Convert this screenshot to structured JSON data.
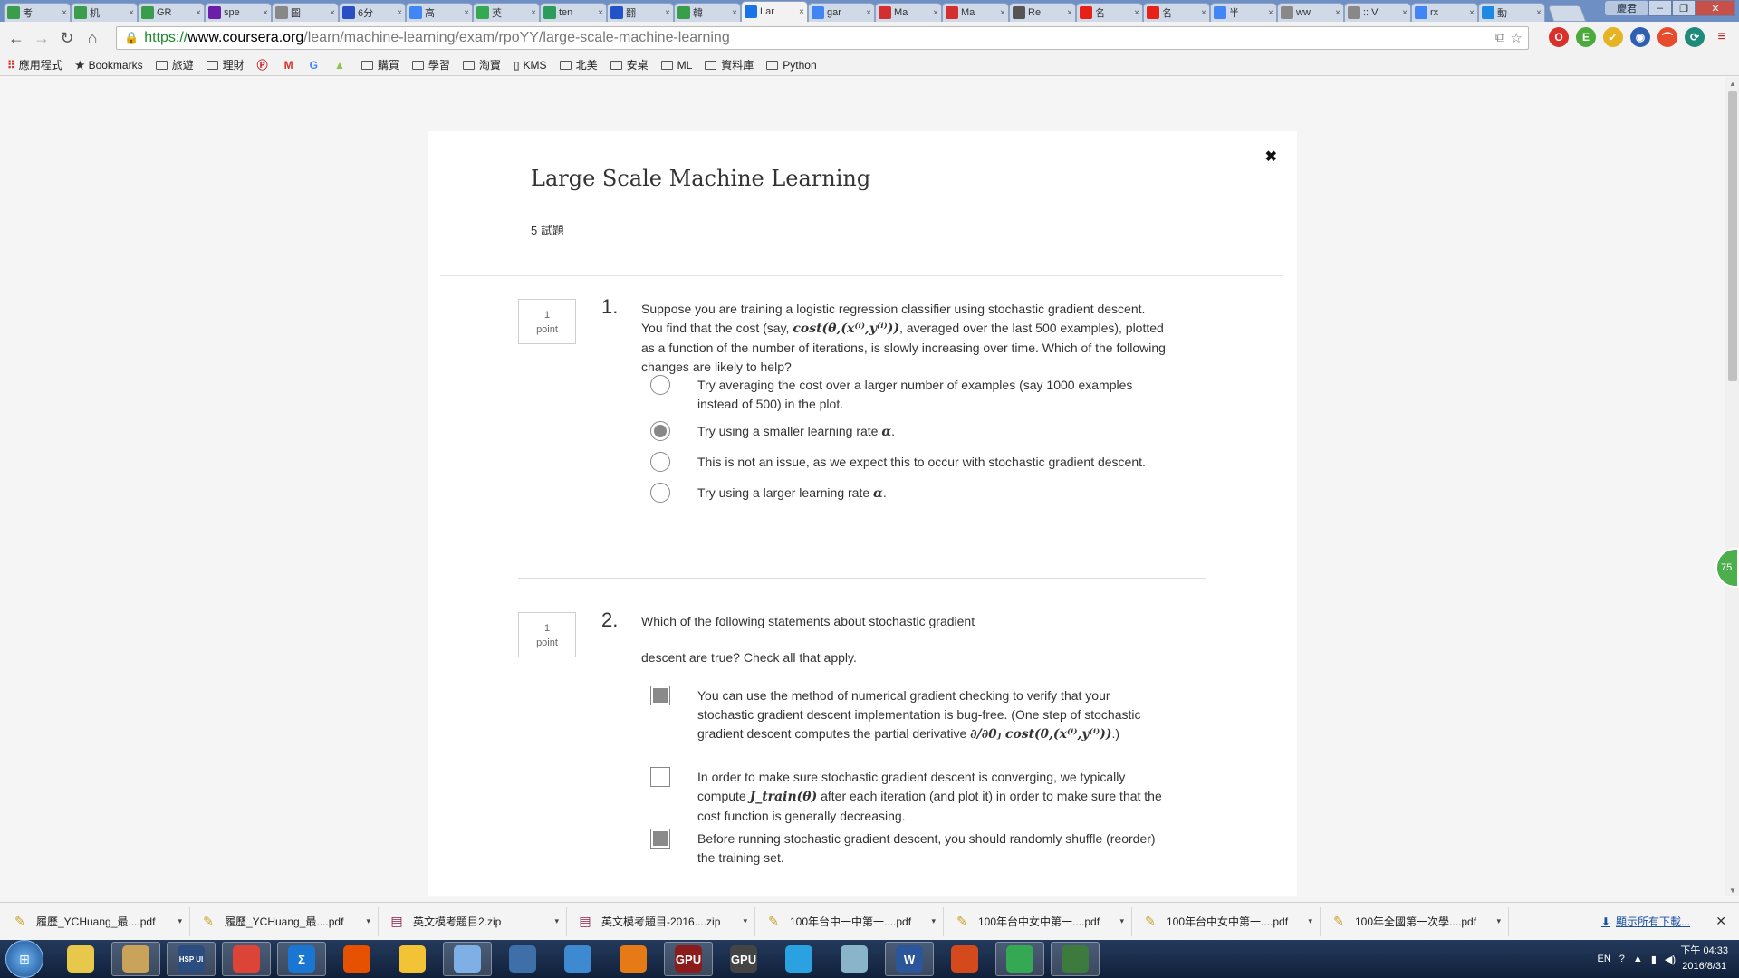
{
  "browser": {
    "tabs": [
      {
        "label": "考",
        "color": "#3a9d4b"
      },
      {
        "label": "机",
        "color": "#3a9d4b"
      },
      {
        "label": "GR",
        "color": "#3a9d4b"
      },
      {
        "label": "spe",
        "color": "#6b1fa8"
      },
      {
        "label": "圖",
        "color": "#888888"
      },
      {
        "label": "6分",
        "color": "#2a4fc4"
      },
      {
        "label": "高",
        "color": "#4285f4"
      },
      {
        "label": "英",
        "color": "#34a853"
      },
      {
        "label": "ten",
        "color": "#2c9c5a"
      },
      {
        "label": "翻",
        "color": "#2052c8"
      },
      {
        "label": "韓",
        "color": "#3a9d4b"
      },
      {
        "label": "Lar",
        "color": "#1a73e8"
      },
      {
        "label": "gar",
        "color": "#4285f4"
      },
      {
        "label": "Ma",
        "color": "#d32f2f"
      },
      {
        "label": "Ma",
        "color": "#d32f2f"
      },
      {
        "label": "Re",
        "color": "#555555"
      },
      {
        "label": "名",
        "color": "#e62117"
      },
      {
        "label": "名",
        "color": "#e62117"
      },
      {
        "label": "半",
        "color": "#4285f4"
      },
      {
        "label": "ww",
        "color": "#888888"
      },
      {
        "label": ":: V",
        "color": "#888888"
      },
      {
        "label": "rx",
        "color": "#4285f4"
      },
      {
        "label": "動",
        "color": "#1e88e5"
      }
    ],
    "active_tab_index": 11,
    "profile": "慶君",
    "url": {
      "scheme": "https://",
      "host": "www.coursera.org",
      "path": "/learn/machine-learning/exam/rpoYY/large-scale-machine-learning"
    },
    "bookmarks": [
      {
        "label": "應用程式",
        "type": "apps"
      },
      {
        "label": "Bookmarks",
        "type": "star"
      },
      {
        "label": "旅遊",
        "type": "folder"
      },
      {
        "label": "理財",
        "type": "folder"
      },
      {
        "label": "",
        "type": "pinterest"
      },
      {
        "label": "",
        "type": "gmail"
      },
      {
        "label": "",
        "type": "google"
      },
      {
        "label": "",
        "type": "android"
      },
      {
        "label": "購買",
        "type": "folder"
      },
      {
        "label": "學習",
        "type": "folder"
      },
      {
        "label": "淘寶",
        "type": "folder"
      },
      {
        "label": "KMS",
        "type": "page"
      },
      {
        "label": "北美",
        "type": "folder"
      },
      {
        "label": "安桌",
        "type": "folder"
      },
      {
        "label": "ML",
        "type": "folder"
      },
      {
        "label": "資料庫",
        "type": "folder"
      },
      {
        "label": "Python",
        "type": "folder"
      }
    ]
  },
  "quiz": {
    "title": "Large Scale Machine Learning",
    "count": "5 試題",
    "questions": [
      {
        "points_num": "1",
        "points_label": "point",
        "number": "1.",
        "text_a": "Suppose you are training a logistic regression classifier using stochastic gradient descent. You find that the cost (say, ",
        "math_a": "cost(θ,(x⁽ⁱ⁾,y⁽ⁱ⁾))",
        "text_b": ", averaged over the last 500 examples), plotted as a function of the number of iterations, is slowly increasing over time. Which of the following changes are likely to help?",
        "options": [
          {
            "text": "Try averaging the cost over a larger number of examples (say 1000 examples instead of 500) in the plot.",
            "math": "",
            "suffix": "",
            "checked": false
          },
          {
            "text": "Try using a smaller learning rate ",
            "math": "α",
            "suffix": ".",
            "checked": true
          },
          {
            "text": "This is not an issue, as we expect this to occur with stochastic gradient descent.",
            "math": "",
            "suffix": "",
            "checked": false
          },
          {
            "text": "Try using a larger learning rate ",
            "math": "α",
            "suffix": ".",
            "checked": false
          }
        ]
      },
      {
        "points_num": "1",
        "points_label": "point",
        "number": "2.",
        "text_line1": "Which of the following statements about stochastic gradient",
        "text_line2": "descent are true? Check all that apply.",
        "options": [
          {
            "text": "You can use the method of numerical gradient checking to verify that your stochastic gradient descent implementation is bug-free. (One step of stochastic gradient descent computes the partial derivative ",
            "math": "∂/∂θⱼ cost(θ,(x⁽ⁱ⁾,y⁽ⁱ⁾))",
            "suffix": ".)",
            "checked": true
          },
          {
            "text": "In order to make sure stochastic gradient descent is converging, we typically compute ",
            "math": "J_train(θ)",
            "suffix": " after each iteration (and plot it) in order to make sure that the cost function is generally decreasing.",
            "checked": false
          },
          {
            "text": "Before running stochastic gradient descent, you should randomly shuffle (reorder) the training set.",
            "math": "",
            "suffix": "",
            "checked": true
          }
        ]
      }
    ]
  },
  "side_badge": "75",
  "downloads": {
    "items": [
      "履歷_YCHuang_最....pdf",
      "履歷_YCHuang_最....pdf",
      "英文模考題目2.zip",
      "英文模考題目-2016....zip",
      "100年台中一中第一....pdf",
      "100年台中女中第一....pdf",
      "100年台中女中第一....pdf",
      "100年全國第一次學....pdf"
    ],
    "show_all": "顯示所有下載..."
  },
  "taskbar": {
    "apps": [
      {
        "label": "",
        "color": "#e8c84a"
      },
      {
        "label": "",
        "color": "#c9a35a"
      },
      {
        "label": "HSP UI",
        "color": "#2b4c7e"
      },
      {
        "label": "",
        "color": "#db4437"
      },
      {
        "label": "Σ",
        "color": "#1976d2"
      },
      {
        "label": "",
        "color": "#e65100"
      },
      {
        "label": "",
        "color": "#f2c335"
      },
      {
        "label": "",
        "color": "#7fb0e5"
      },
      {
        "label": "",
        "color": "#3e6fa8"
      },
      {
        "label": "",
        "color": "#3e8ad0"
      },
      {
        "label": "",
        "color": "#e57a16"
      },
      {
        "label": "GPU",
        "color": "#8b1c1c"
      },
      {
        "label": "GPU",
        "color": "#444444"
      },
      {
        "label": "",
        "color": "#2aa1e0"
      },
      {
        "label": "",
        "color": "#8ab4c9"
      },
      {
        "label": "W",
        "color": "#2b579a"
      },
      {
        "label": "",
        "color": "#d44a1c"
      },
      {
        "label": "",
        "color": "#34a853"
      },
      {
        "label": "",
        "color": "#3d7a3d"
      }
    ],
    "lang": "EN",
    "time": "下午 04:33",
    "date": "2016/8/31"
  }
}
